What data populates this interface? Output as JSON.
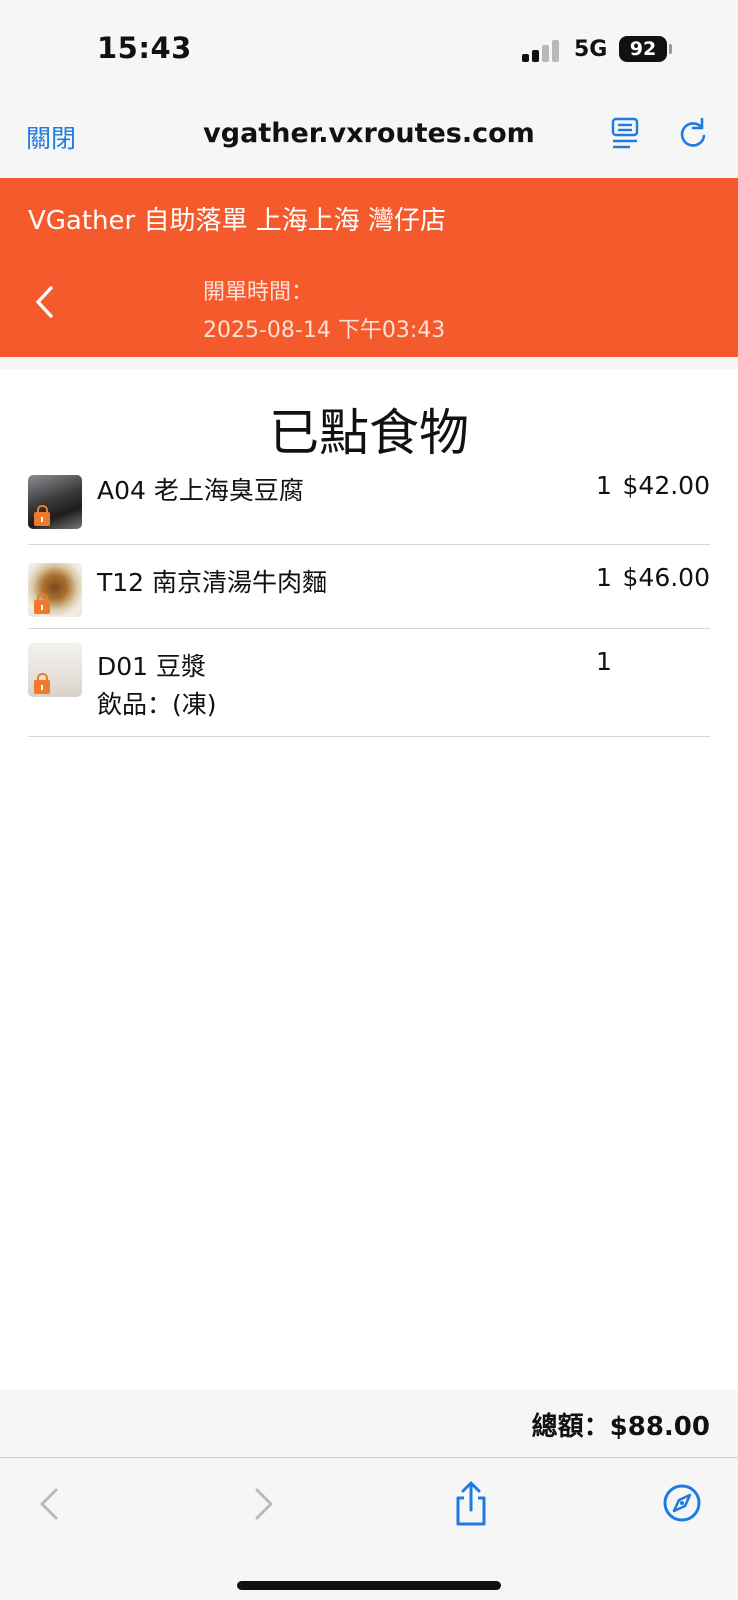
{
  "status_bar": {
    "time": "15:43",
    "network": "5G",
    "battery": "92"
  },
  "browser": {
    "close_label": "關閉",
    "url": "vgather.vxroutes.com"
  },
  "header": {
    "shop_name": "VGather 自助落單 上海上海 灣仔店",
    "open_time_label": "開單時間：",
    "open_time_value": "2025-08-14 下午03:43"
  },
  "order": {
    "title": "已點食物",
    "items": [
      {
        "name": "A04 老上海臭豆腐",
        "option": "",
        "qty": "1",
        "price": "$42.00",
        "thumb_icon": "stinky-tofu-photo"
      },
      {
        "name": "T12 南京清湯牛肉麵",
        "option": "",
        "qty": "1",
        "price": "$46.00",
        "thumb_icon": "beef-noodle-photo"
      },
      {
        "name": "D01 豆漿",
        "option": "飲品：(凍)",
        "qty": "1",
        "price": "",
        "thumb_icon": "soy-milk-photo"
      }
    ]
  },
  "total": {
    "text": "總額：$88.00"
  },
  "colors": {
    "accent": "#f55a2d",
    "link": "#1f7be0",
    "lock": "#ee7a2c"
  },
  "toolbar": {
    "icons": [
      "back-arrow-icon",
      "forward-arrow-icon",
      "share-icon",
      "compass-icon"
    ]
  }
}
